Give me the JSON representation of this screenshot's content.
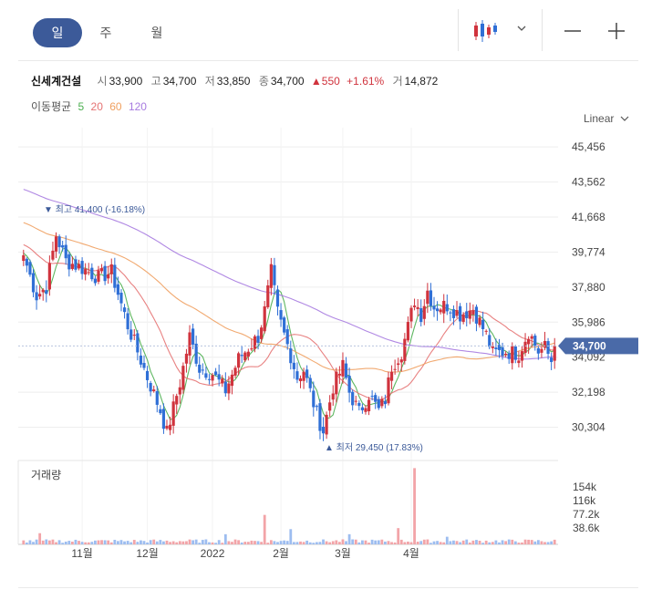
{
  "toolbar": {
    "tabs": [
      {
        "label": "일",
        "active": true
      },
      {
        "label": "주",
        "active": false
      },
      {
        "label": "월",
        "active": false
      }
    ],
    "chart_type_icon": "candlestick-icon",
    "dropdown_icon": "chevron-down-icon",
    "zoom_out_icon": "minus-icon",
    "zoom_in_icon": "plus-icon"
  },
  "info": {
    "name": "신세계건설",
    "open_label": "시",
    "open": "33,900",
    "high_label": "고",
    "high": "34,700",
    "low_label": "저",
    "low": "33,850",
    "close_label": "종",
    "close": "34,700",
    "change": "▲550",
    "change_pct": "+1.61%",
    "volume_label": "거",
    "volume": "14,872"
  },
  "ma": {
    "label": "이동평균",
    "periods": [
      {
        "label": "5",
        "color": "#4caf50"
      },
      {
        "label": "20",
        "color": "#e57373"
      },
      {
        "label": "60",
        "color": "#f0a060"
      },
      {
        "label": "120",
        "color": "#a77be0"
      }
    ]
  },
  "scale_label": "Linear",
  "colors": {
    "up": "#d0333d",
    "down": "#2f6fd6",
    "current_bg": "#4a6aa8"
  },
  "chart_data": {
    "type": "candlestick",
    "y_ticks": [
      "45,456",
      "43,562",
      "41,668",
      "39,774",
      "37,880",
      "35,986",
      "34,092",
      "32,198",
      "30,304"
    ],
    "ylim": [
      29000,
      46500
    ],
    "x_ticks": [
      "11월",
      "12월",
      "2022",
      "2월",
      "3월",
      "4월"
    ],
    "current_price": "34,700",
    "max_annotation": "최고 41,400 (-16.18%)",
    "min_annotation": "최저 29,450 (17.83%)",
    "volume_title": "거래량",
    "volume_ticks": [
      "154k",
      "116k",
      "77.2k",
      "38.6k"
    ],
    "anchors": [
      [
        0,
        39600
      ],
      [
        4,
        37400
      ],
      [
        7,
        37900
      ],
      [
        10,
        40700
      ],
      [
        13,
        39300
      ],
      [
        18,
        38900
      ],
      [
        23,
        38400
      ],
      [
        27,
        38700
      ],
      [
        32,
        35800
      ],
      [
        38,
        33000
      ],
      [
        42,
        31200
      ],
      [
        44,
        30000
      ],
      [
        48,
        32700
      ],
      [
        51,
        35200
      ],
      [
        54,
        33500
      ],
      [
        58,
        33200
      ],
      [
        62,
        32300
      ],
      [
        66,
        34000
      ],
      [
        72,
        35200
      ],
      [
        74,
        36600
      ],
      [
        76,
        38700
      ],
      [
        78,
        36500
      ],
      [
        80,
        35300
      ],
      [
        82,
        34200
      ],
      [
        84,
        33000
      ],
      [
        86,
        33400
      ],
      [
        90,
        31000
      ],
      [
        92,
        30100
      ],
      [
        95,
        32500
      ],
      [
        98,
        33600
      ],
      [
        100,
        32200
      ],
      [
        103,
        31100
      ],
      [
        106,
        32100
      ],
      [
        109,
        31200
      ],
      [
        111,
        31800
      ],
      [
        113,
        33600
      ],
      [
        116,
        34400
      ],
      [
        118,
        35700
      ],
      [
        120,
        37200
      ],
      [
        122,
        36400
      ],
      [
        124,
        37700
      ],
      [
        126,
        36800
      ],
      [
        130,
        36900
      ],
      [
        134,
        36400
      ],
      [
        138,
        36700
      ],
      [
        142,
        35300
      ],
      [
        144,
        34300
      ],
      [
        148,
        34400
      ],
      [
        152,
        34300
      ],
      [
        155,
        35500
      ],
      [
        158,
        34400
      ],
      [
        160,
        34600
      ],
      [
        162,
        33900
      ],
      [
        163,
        34700
      ]
    ],
    "volume_spikes": [
      [
        74,
        58000
      ],
      [
        115,
        32000
      ],
      [
        120,
        150000
      ],
      [
        82,
        30000
      ],
      [
        62,
        20000
      ],
      [
        100,
        20000
      ],
      [
        5,
        22000
      ],
      [
        130,
        15000
      ]
    ],
    "ma_window": [
      5,
      20,
      60,
      120
    ]
  }
}
